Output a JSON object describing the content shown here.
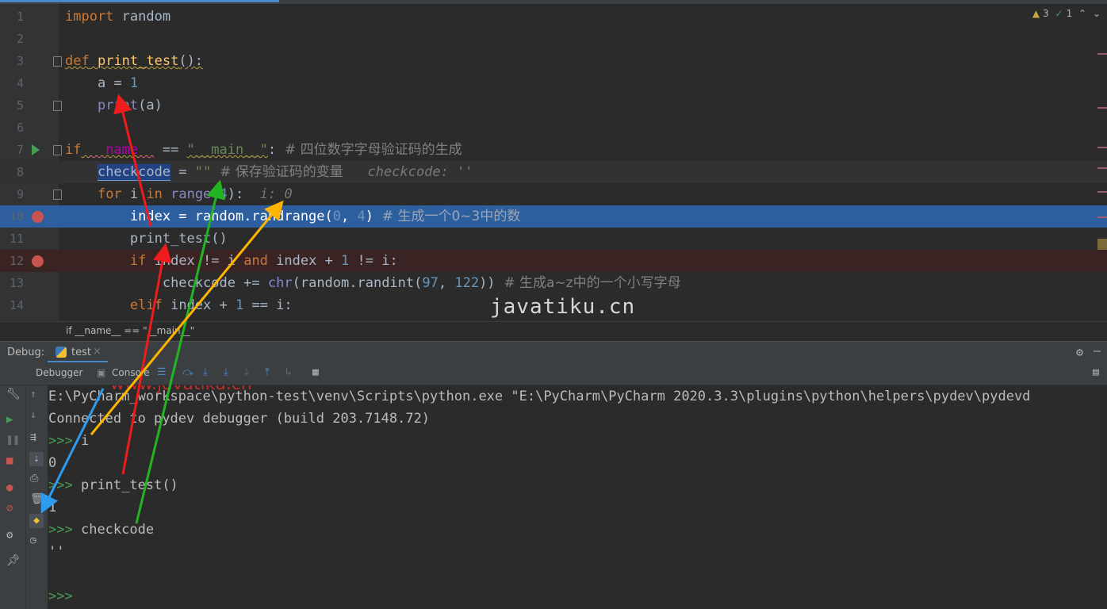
{
  "editor": {
    "lines": [
      {
        "n": "1"
      },
      {
        "n": "2"
      },
      {
        "n": "3"
      },
      {
        "n": "4"
      },
      {
        "n": "5"
      },
      {
        "n": "6"
      },
      {
        "n": "7"
      },
      {
        "n": "8"
      },
      {
        "n": "9"
      },
      {
        "n": "10"
      },
      {
        "n": "11"
      },
      {
        "n": "12"
      },
      {
        "n": "13"
      },
      {
        "n": "14"
      }
    ],
    "inspections": {
      "warnings": "3",
      "checks": "1"
    },
    "watermark": "javatiku.cn",
    "code": {
      "l1_kw": "import",
      "l1_rest": " random",
      "l3_kw": "def",
      "l3_fn": "print_test",
      "l3_rest": "():",
      "l4_a": "a",
      "l4_eq": " = ",
      "l4_num": "1",
      "l5_fn": "print",
      "l5_rest": "(a)",
      "l7_kw": "if",
      "l7_d1": " __name__",
      "l7_op": " == ",
      "l7_str": "\"__main__\"",
      "l7_colon": ":",
      "l7_cm": "  # 四位数字字母验证码的生成",
      "l8_var": "checkcode",
      "l8_eq": " = ",
      "l8_str": "\"\"",
      "l8_cm": "  # 保存验证码的变量",
      "l8_hint": "   checkcode: ''",
      "l9_for": "for",
      "l9_i": " i ",
      "l9_in": "in",
      "l9_range": " range",
      "l9_paren": "(",
      "l9_num": "4",
      "l9_close": "):",
      "l9_hint": "  i: 0",
      "l10_a": "index = random.randrange(",
      "l10_n1": "0",
      "l10_comma": ", ",
      "l10_n2": "4",
      "l10_close": ")",
      "l10_cm": "  # 生成一个0~3中的数",
      "l11": "print_test()",
      "l12_if": "if",
      "l12_a": " index != i ",
      "l12_and": "and",
      "l12_b": " index + ",
      "l12_num": "1",
      "l12_c": " != i:",
      "l13_a": "checkcode += ",
      "l13_chr": "chr",
      "l13_b": "(random.randint(",
      "l13_n1": "97",
      "l13_comma": ", ",
      "l13_n2": "122",
      "l13_c": "))",
      "l13_cm": "  # 生成a~z中的一个小写字母",
      "l14_kw": "elif",
      "l14_a": " index + ",
      "l14_num": "1",
      "l14_b": " == i:"
    }
  },
  "breadcrumb": "if __name__ == \"__main__\"",
  "debug": {
    "label": "Debug:",
    "tab": "test",
    "tab_close": "×",
    "toolbar": {
      "debugger": "Debugger",
      "console": "Console"
    }
  },
  "console": {
    "watermark": "www.javatiku.cn",
    "lines": [
      "E:\\PyCharm_workspace\\python-test\\venv\\Scripts\\python.exe \"E:\\PyCharm\\PyCharm 2020.3.3\\plugins\\python\\helpers\\pydev\\pydevd",
      "Connected to pydev debugger (build 203.7148.72)",
      ">>>",
      "i",
      "0",
      ">>>",
      "print_test()",
      "1",
      ">>>",
      "checkcode",
      "''",
      ">>>"
    ]
  },
  "colors": {
    "selection": "#2d5f9e",
    "breakpoint": "#c75450",
    "prompt": "#499c54"
  },
  "arrows": [
    "red",
    "red",
    "green",
    "orange",
    "blue"
  ]
}
